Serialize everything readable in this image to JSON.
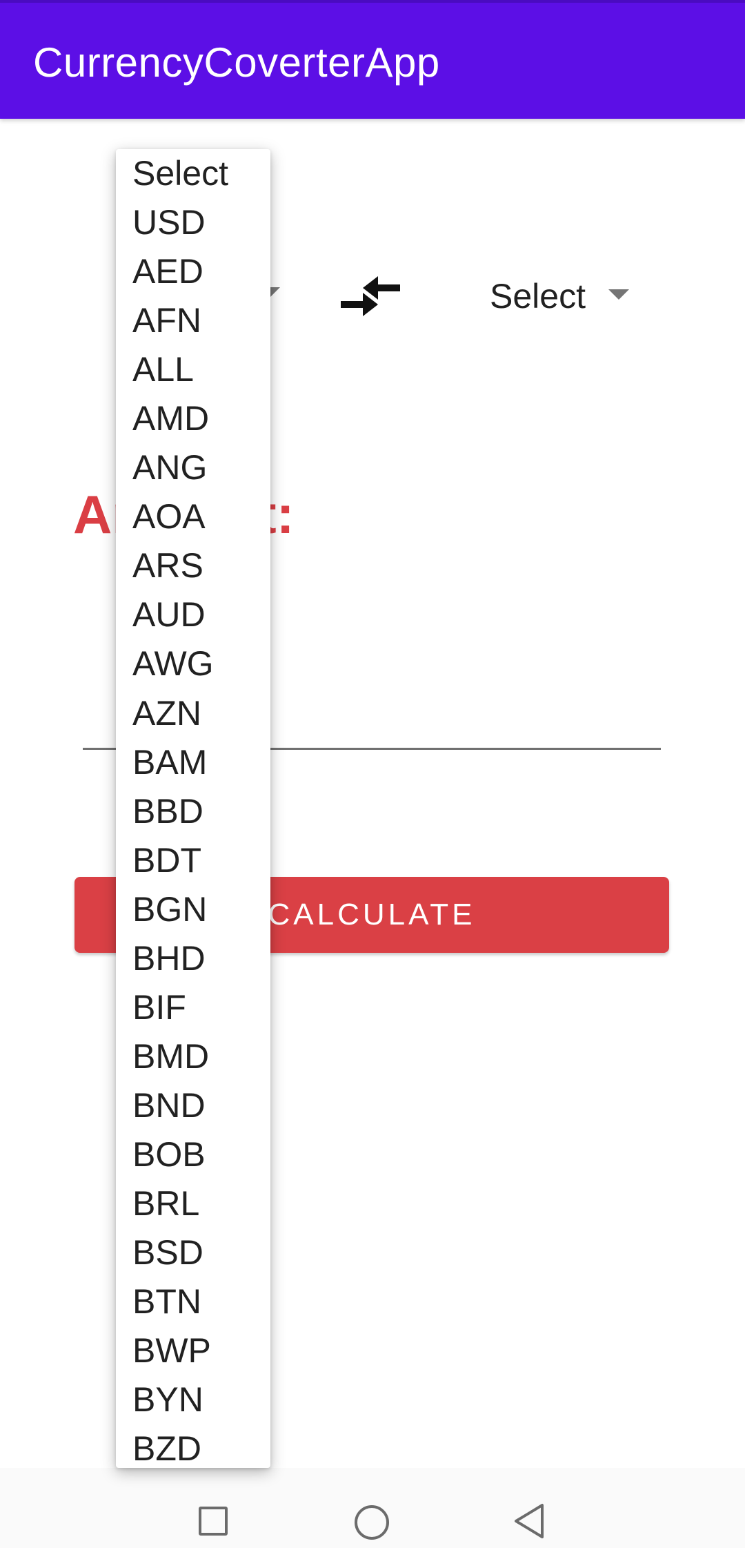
{
  "app_bar": {
    "title": "CurrencyCoverterApp",
    "background": "#5c0fe6"
  },
  "converter": {
    "from_select": {
      "selected": "Select"
    },
    "swap_icon": "swap-arrows-icon",
    "to_select": {
      "selected": "Select"
    },
    "amount_label": "Amount:",
    "amount_input": {
      "value": "",
      "placeholder": ""
    },
    "calculate_label": "CALCULATE",
    "accent_color": "#da4045"
  },
  "dropdown": {
    "options": [
      "Select",
      "USD",
      "AED",
      "AFN",
      "ALL",
      "AMD",
      "ANG",
      "AOA",
      "ARS",
      "AUD",
      "AWG",
      "AZN",
      "BAM",
      "BBD",
      "BDT",
      "BGN",
      "BHD",
      "BIF",
      "BMD",
      "BND",
      "BOB",
      "BRL",
      "BSD",
      "BTN",
      "BWP",
      "BYN",
      "BZD"
    ]
  },
  "nav_bar": {
    "icons": [
      "recents-icon",
      "home-icon",
      "back-icon"
    ]
  }
}
